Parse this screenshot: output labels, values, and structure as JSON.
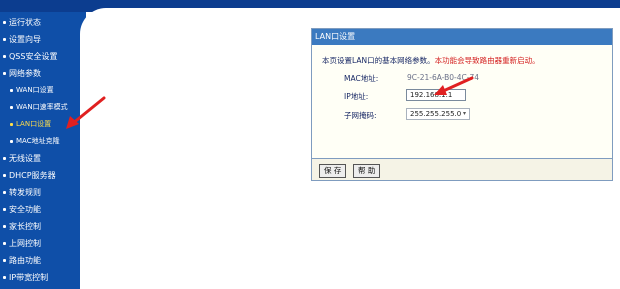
{
  "sidebar": {
    "items": [
      {
        "label": "运行状态",
        "level": "main"
      },
      {
        "label": "设置向导",
        "level": "main"
      },
      {
        "label": "QSS安全设置",
        "level": "main"
      },
      {
        "label": "网络参数",
        "level": "main"
      },
      {
        "label": "WAN口设置",
        "level": "sub"
      },
      {
        "label": "WAN口速率模式",
        "level": "sub"
      },
      {
        "label": "LAN口设置",
        "level": "sub",
        "active": true
      },
      {
        "label": "MAC地址克隆",
        "level": "sub"
      },
      {
        "label": "无线设置",
        "level": "main"
      },
      {
        "label": "DHCP服务器",
        "level": "main"
      },
      {
        "label": "转发规则",
        "level": "main"
      },
      {
        "label": "安全功能",
        "level": "main"
      },
      {
        "label": "家长控制",
        "level": "main"
      },
      {
        "label": "上网控制",
        "level": "main"
      },
      {
        "label": "路由功能",
        "level": "main"
      },
      {
        "label": "IP带宽控制",
        "level": "main"
      }
    ]
  },
  "panel": {
    "title": "LAN口设置",
    "description": "本页设置LAN口的基本网络参数。",
    "warning": "本功能会导致路由器重新启动。",
    "mac_label": "MAC地址:",
    "mac_value": "9C-21-6A-B0-4C-74",
    "ip_label": "IP地址:",
    "ip_value": "192.168.1.1",
    "mask_label": "子网掩码:",
    "mask_value": "255.255.255.0",
    "save_label": "保 存",
    "help_label": "帮 助"
  },
  "colors": {
    "sidebar_bg": "#0f4fa8",
    "panel_header": "#3b7ac0",
    "warning_text": "#d42020",
    "active_nav": "#ffde4a",
    "annotation_arrow": "#e02020"
  },
  "icons": {
    "select_caret": "chevron-down-icon",
    "annotation": "red-arrow-icon"
  }
}
